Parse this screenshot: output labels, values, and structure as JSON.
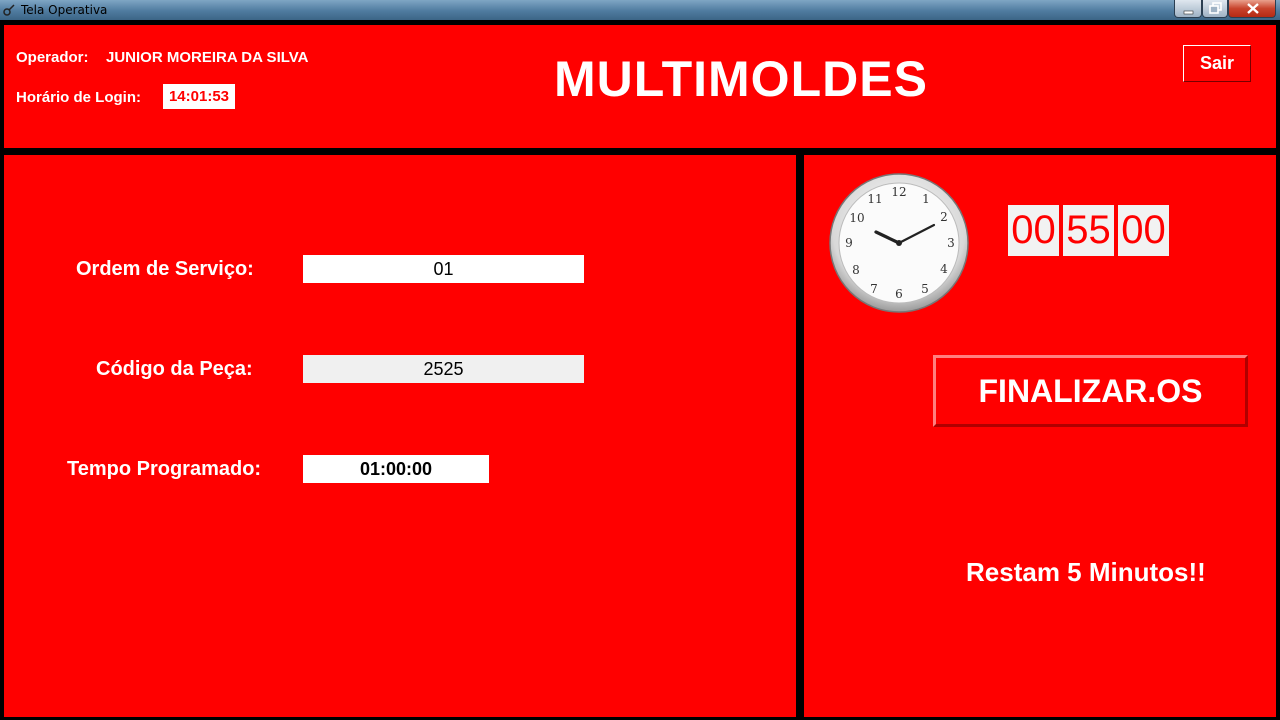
{
  "window": {
    "title": "Tela Operativa",
    "controls": [
      "minimize-icon",
      "maximize-icon",
      "close-icon"
    ]
  },
  "header": {
    "operator_label": "Operador:",
    "operator_name": "JUNIOR MOREIRA DA SILVA",
    "login_label": "Horário de Login:",
    "login_time": "14:01:53",
    "brand": "MULTIMOLDES",
    "exit_button": "Sair"
  },
  "form": {
    "os_label": "Ordem de Serviço:",
    "os_value": "01",
    "code_label": "Código da Peça:",
    "code_value": "2525",
    "time_label": "Tempo Programado:",
    "time_value": "01:00:00"
  },
  "timer": {
    "clock_icon": "analog-clock-icon",
    "hours": "00",
    "minutes": "55",
    "seconds": "00",
    "finish_button": "FINALIZAR.OS",
    "warning": "Restam 5 Minutos!!"
  },
  "colors": {
    "panel_red": "#ff0000",
    "frame": "#000000",
    "text_white": "#ffffff"
  }
}
